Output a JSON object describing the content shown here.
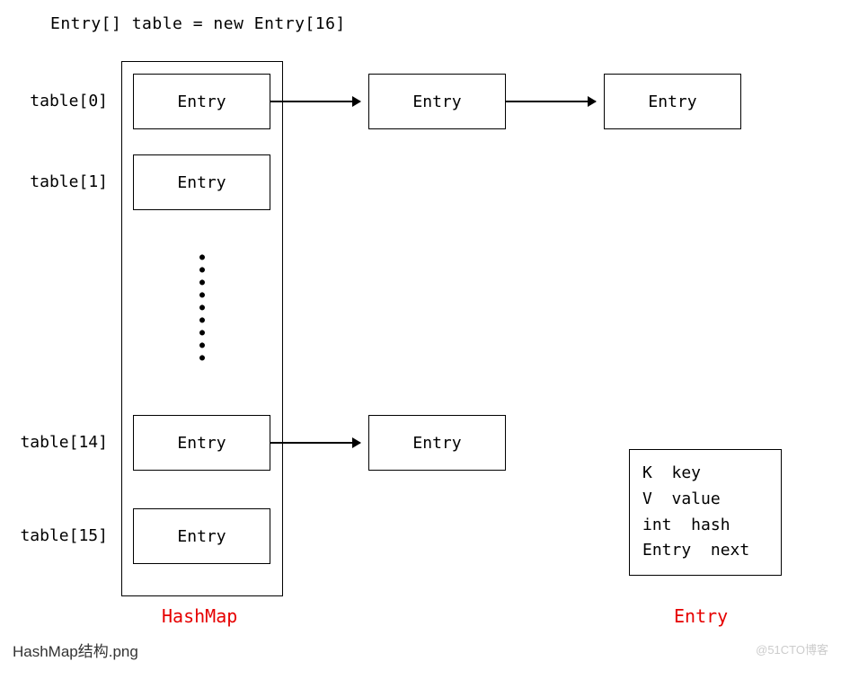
{
  "declaration": "Entry[] table = new Entry[16]",
  "indices": {
    "i0": "table[0]",
    "i1": "table[1]",
    "i14": "table[14]",
    "i15": "table[15]"
  },
  "cell": "Entry",
  "labels": {
    "hashmap": "HashMap",
    "entry": "Entry"
  },
  "entry_def": "K  key\nV  value\nint  hash\nEntry  next",
  "caption": "HashMap结构.png",
  "watermark": "@51CTO博客"
}
